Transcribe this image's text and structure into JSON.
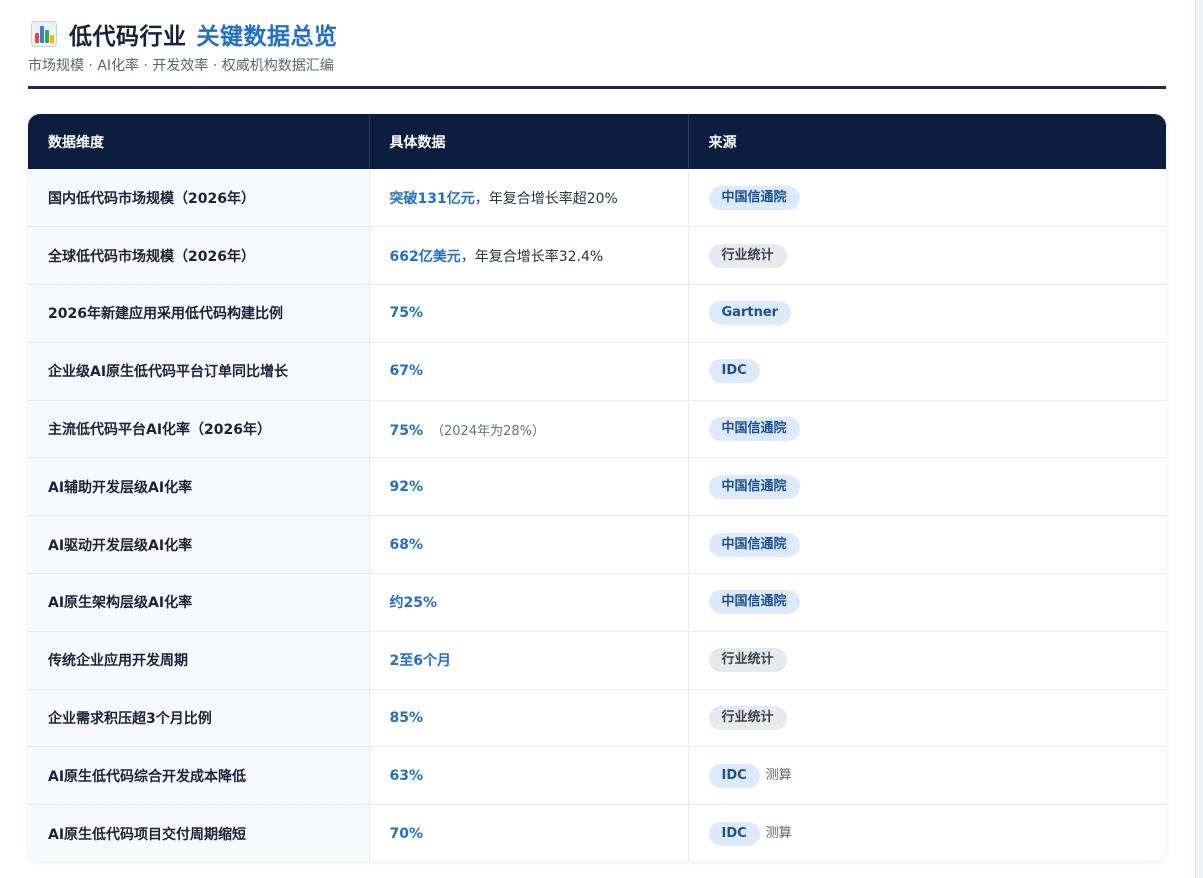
{
  "header": {
    "title_main": "低代码行业",
    "title_accent": "关键数据总览",
    "subtitle": "市场规模 · AI化率 · 开发效率 · 权威机构数据汇编"
  },
  "table": {
    "columns": [
      "数据维度",
      "具体数据",
      "来源"
    ],
    "rows": [
      {
        "dimension": "国内低代码市场规模（2026年）",
        "value": "突破131亿元",
        "rest": "，年复合增长率超20%",
        "note": "",
        "source": "中国信通院",
        "source_style": "blue",
        "source_note": ""
      },
      {
        "dimension": "全球低代码市场规模（2026年）",
        "value": "662亿美元",
        "rest": "，年复合增长率32.4%",
        "note": "",
        "source": "行业统计",
        "source_style": "gray",
        "source_note": ""
      },
      {
        "dimension": "2026年新建应用采用低代码构建比例",
        "value": "75%",
        "rest": "",
        "note": "",
        "source": "Gartner",
        "source_style": "blue",
        "source_note": ""
      },
      {
        "dimension": "企业级AI原生低代码平台订单同比增长",
        "value": "67%",
        "rest": "",
        "note": "",
        "source": "IDC",
        "source_style": "blue",
        "source_note": ""
      },
      {
        "dimension": "主流低代码平台AI化率（2026年）",
        "value": "75%",
        "rest": "",
        "note": "（2024年为28%）",
        "source": "中国信通院",
        "source_style": "blue",
        "source_note": ""
      },
      {
        "dimension": "AI辅助开发层级AI化率",
        "value": "92%",
        "rest": "",
        "note": "",
        "source": "中国信通院",
        "source_style": "blue",
        "source_note": ""
      },
      {
        "dimension": "AI驱动开发层级AI化率",
        "value": "68%",
        "rest": "",
        "note": "",
        "source": "中国信通院",
        "source_style": "blue",
        "source_note": ""
      },
      {
        "dimension": "AI原生架构层级AI化率",
        "value": "约25%",
        "rest": "",
        "note": "",
        "source": "中国信通院",
        "source_style": "blue",
        "source_note": ""
      },
      {
        "dimension": "传统企业应用开发周期",
        "value": "2至6个月",
        "rest": "",
        "note": "",
        "source": "行业统计",
        "source_style": "gray",
        "source_note": ""
      },
      {
        "dimension": "企业需求积压超3个月比例",
        "value": "85%",
        "rest": "",
        "note": "",
        "source": "行业统计",
        "source_style": "gray",
        "source_note": ""
      },
      {
        "dimension": "AI原生低代码综合开发成本降低",
        "value": "63%",
        "rest": "",
        "note": "",
        "source": "IDC",
        "source_style": "blue",
        "source_note": "测算"
      },
      {
        "dimension": "AI原生低代码项目交付周期缩短",
        "value": "70%",
        "rest": "",
        "note": "",
        "source": "IDC",
        "source_style": "blue",
        "source_note": "测算"
      }
    ]
  }
}
